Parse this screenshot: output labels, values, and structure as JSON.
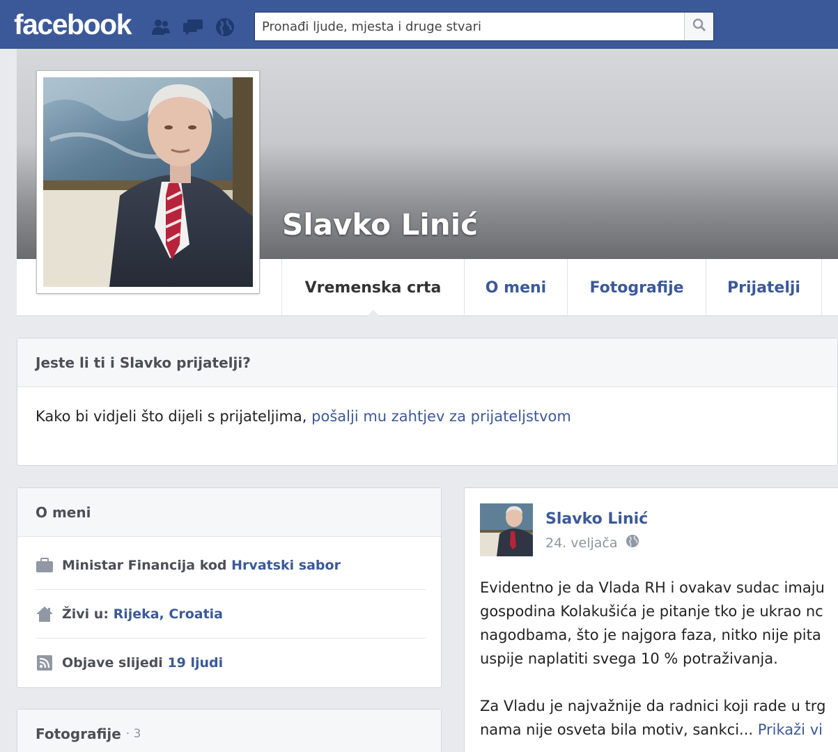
{
  "brand": "facebook",
  "search": {
    "placeholder": "Pronađi ljude, mjesta i druge stvari"
  },
  "profile": {
    "name": "Slavko Linić"
  },
  "tabs": [
    {
      "label": "Vremenska crta"
    },
    {
      "label": "O meni"
    },
    {
      "label": "Fotografije"
    },
    {
      "label": "Prijatelji"
    }
  ],
  "friend_prompt": {
    "title": "Jeste li ti i Slavko prijatelji?",
    "text": "Kako bi vidjeli što dijeli s prijateljima, ",
    "link": "pošalji mu zahtjev za prijateljstvom"
  },
  "about": {
    "title": "O meni",
    "work": {
      "prefix": "Ministar Financija kod ",
      "link": "Hrvatski sabor"
    },
    "lives": {
      "prefix": "Živi u: ",
      "link": "Rijeka, Croatia"
    },
    "followers": {
      "prefix": "Objave slijedi ",
      "link": "19 ljudi"
    }
  },
  "photos": {
    "title": "Fotografije",
    "count": "· 3"
  },
  "post": {
    "author": "Slavko Linić",
    "date": "24. veljača",
    "lines1": [
      "Evidentno je da Vlada RH i ovakav sudac imaju",
      "gospodina Kolakušića je pitanje tko je ukrao nc",
      "nagodbama, što je najgora faza, nitko nije pita",
      "uspije naplatiti svega 10 % potraživanja."
    ],
    "lines2": [
      "Za Vladu je najvažnije da radnici koji rade u trg"
    ],
    "last_line": "nama nije osveta bila motiv, sankci... ",
    "more": "Prikaži vi"
  },
  "icons": {
    "friends": "friends-icon",
    "messages": "messages-icon",
    "notifications": "globe-icon",
    "search": "search-icon",
    "briefcase": "briefcase-icon",
    "home": "home-icon",
    "rss": "rss-icon",
    "public": "globe-icon"
  },
  "colors": {
    "brand": "#3b5998",
    "background": "#e9eaed"
  }
}
